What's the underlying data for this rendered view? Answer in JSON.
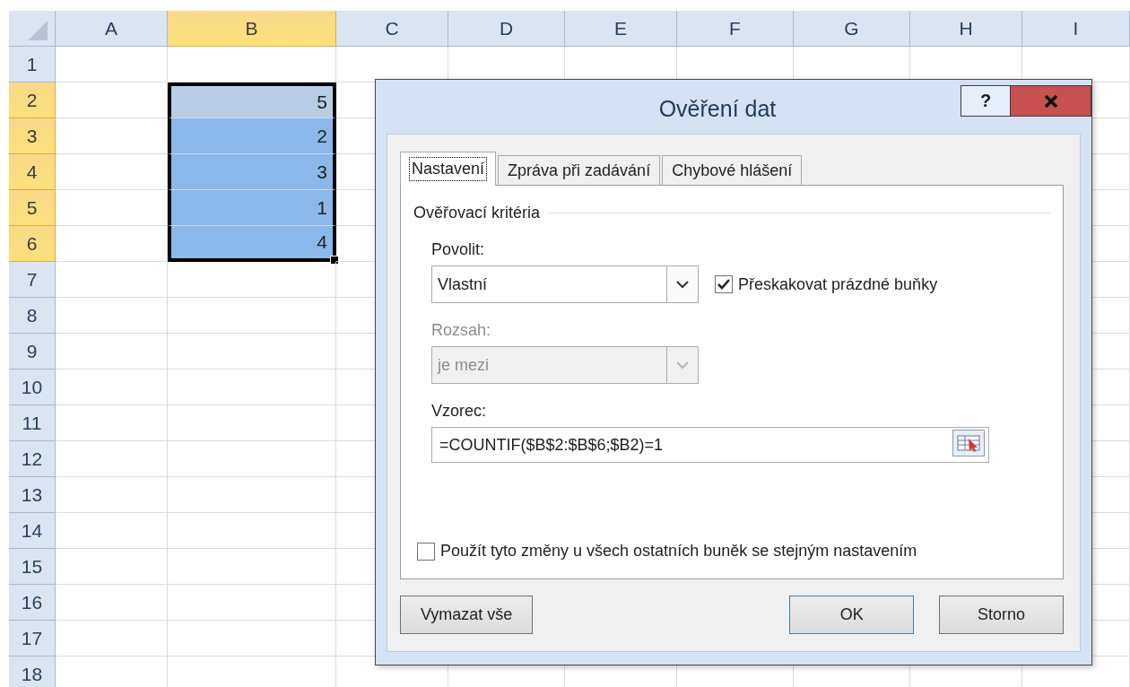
{
  "sheet": {
    "columns": [
      {
        "label": "A",
        "selected": false
      },
      {
        "label": "B",
        "selected": true
      },
      {
        "label": "C",
        "selected": false
      },
      {
        "label": "D",
        "selected": false
      },
      {
        "label": "E",
        "selected": false
      },
      {
        "label": "F",
        "selected": false
      },
      {
        "label": "G",
        "selected": false
      },
      {
        "label": "H",
        "selected": false
      },
      {
        "label": "I",
        "selected": false
      }
    ],
    "rows": [
      {
        "label": "1",
        "selected": false
      },
      {
        "label": "2",
        "selected": true,
        "column_b": {
          "value": "5",
          "active": true
        }
      },
      {
        "label": "3",
        "selected": true,
        "column_b": {
          "value": "2",
          "active": false
        }
      },
      {
        "label": "4",
        "selected": true,
        "column_b": {
          "value": "3",
          "active": false
        }
      },
      {
        "label": "5",
        "selected": true,
        "column_b": {
          "value": "1",
          "active": false
        }
      },
      {
        "label": "6",
        "selected": true,
        "column_b": {
          "value": "4",
          "active": false
        }
      },
      {
        "label": "7",
        "selected": false
      },
      {
        "label": "8",
        "selected": false
      },
      {
        "label": "9",
        "selected": false
      },
      {
        "label": "10",
        "selected": false
      },
      {
        "label": "11",
        "selected": false
      },
      {
        "label": "12",
        "selected": false
      },
      {
        "label": "13",
        "selected": false
      },
      {
        "label": "14",
        "selected": false
      },
      {
        "label": "15",
        "selected": false
      },
      {
        "label": "16",
        "selected": false
      },
      {
        "label": "17",
        "selected": false
      },
      {
        "label": "18",
        "selected": false
      }
    ]
  },
  "dialog": {
    "title": "Ověření dat",
    "help_button": "?",
    "tabs": [
      {
        "label": "Nastavení",
        "selected": true
      },
      {
        "label": "Zpráva při zadávání",
        "selected": false
      },
      {
        "label": "Chybové hlášení",
        "selected": false
      }
    ],
    "group_label": "Ověřovací kritéria",
    "allow": {
      "label": "Povolit:",
      "value": "Vlastní",
      "disabled": false
    },
    "ignore_blank": {
      "label": "Přeskakovat prázdné buňky",
      "checked": true
    },
    "range": {
      "label": "Rozsah:",
      "value": "je mezi",
      "disabled": true
    },
    "formula": {
      "label": "Vzorec:",
      "value": "=COUNTIF($B$2:$B$6;$B2)=1"
    },
    "apply_all": {
      "label": "Použít tyto změny u všech ostatních buněk se stejným nastavením",
      "checked": false
    },
    "buttons": [
      {
        "label": "Vymazat vše",
        "default": false
      },
      {
        "label": "OK",
        "default": true
      },
      {
        "label": "Storno",
        "default": false
      }
    ]
  }
}
